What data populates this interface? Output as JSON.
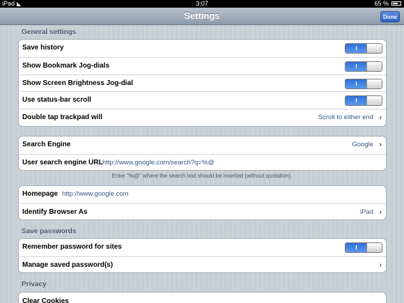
{
  "status_bar": {
    "device": "iPad",
    "wifi_icon": "wifi-icon",
    "time": "3:07",
    "battery": "65 %",
    "battery_icon": "battery-icon"
  },
  "nav": {
    "title": "Settings",
    "done_label": "Done",
    "accent": "#2a5fc7"
  },
  "sections": {
    "general": "General settings",
    "save_passwords": "Save passwords",
    "privacy": "Privacy"
  },
  "general_rows": {
    "save_history": {
      "label": "Save history",
      "toggle": "I",
      "state": "on"
    },
    "bookmark_jog": {
      "label": "Show Bookmark Jog-dials",
      "toggle": "I",
      "state": "on"
    },
    "brightness_jog": {
      "label": "Show Screen Brightness Jog-dial",
      "toggle": "I",
      "state": "on"
    },
    "status_bar_scroll": {
      "label": "Use status-bar scroll",
      "toggle": "I",
      "state": "on"
    },
    "double_tap": {
      "label": "Double tap trackpad will",
      "value": "Scroll to either end"
    }
  },
  "search": {
    "engine_label": "Search Engine",
    "engine_value": "Google",
    "url_label": "User search engine URL",
    "url_value": "http://www.google.com/search?q=%@",
    "footnote": "Enter \"%@\" where the search text should be inserted (without quotation)."
  },
  "browser": {
    "homepage_label": "Homepage",
    "homepage_value": "http://www.google.com",
    "identify_label": "Identify Browser As",
    "identify_value": "iPad"
  },
  "passwords": {
    "remember_label": "Remember password for sites",
    "remember_toggle": "I",
    "remember_state": "on",
    "manage_label": "Manage saved password(s)"
  },
  "privacy": {
    "clear_cookies_label": "Clear Cookies"
  }
}
